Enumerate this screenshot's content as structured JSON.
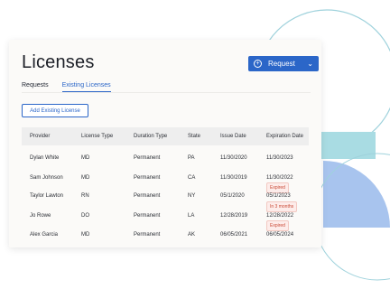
{
  "page": {
    "title": "Licenses"
  },
  "request_button": {
    "label": "Request"
  },
  "tabs": [
    {
      "label": "Requests",
      "active": false
    },
    {
      "label": "Existing Licenses",
      "active": true
    }
  ],
  "add_button": {
    "label": "Add Existing License"
  },
  "table": {
    "columns": [
      "Provider",
      "License Type",
      "Duration Type",
      "State",
      "Issue Date",
      "Expiration Date"
    ],
    "rows": [
      {
        "provider": "Dylan White",
        "license_type": "MD",
        "duration": "Permanent",
        "state": "PA",
        "issue": "11/30/2020",
        "expiration": "11/30/2023",
        "badge": ""
      },
      {
        "provider": "Sam Johnson",
        "license_type": "MD",
        "duration": "Permanent",
        "state": "CA",
        "issue": "11/30/2019",
        "expiration": "11/30/2022",
        "badge": "Expired"
      },
      {
        "provider": "Taylor Lawton",
        "license_type": "RN",
        "duration": "Permanent",
        "state": "NY",
        "issue": "05/1/2020",
        "expiration": "05/1/2023",
        "badge": "In 3 months"
      },
      {
        "provider": "Jo Rowe",
        "license_type": "DO",
        "duration": "Permanent",
        "state": "LA",
        "issue": "12/28/2019",
        "expiration": "12/28/2022",
        "badge": "Expired"
      },
      {
        "provider": "Alex Garcia",
        "license_type": "MD",
        "duration": "Permanent",
        "state": "AK",
        "issue": "06/05/2021",
        "expiration": "06/05/2024",
        "badge": ""
      }
    ]
  },
  "colors": {
    "accent": "#2b66c8",
    "badge_bg": "#fdecea",
    "badge_text": "#c94a36",
    "deco_teal": "#a9dce3",
    "deco_blue": "#a8c4ee"
  }
}
